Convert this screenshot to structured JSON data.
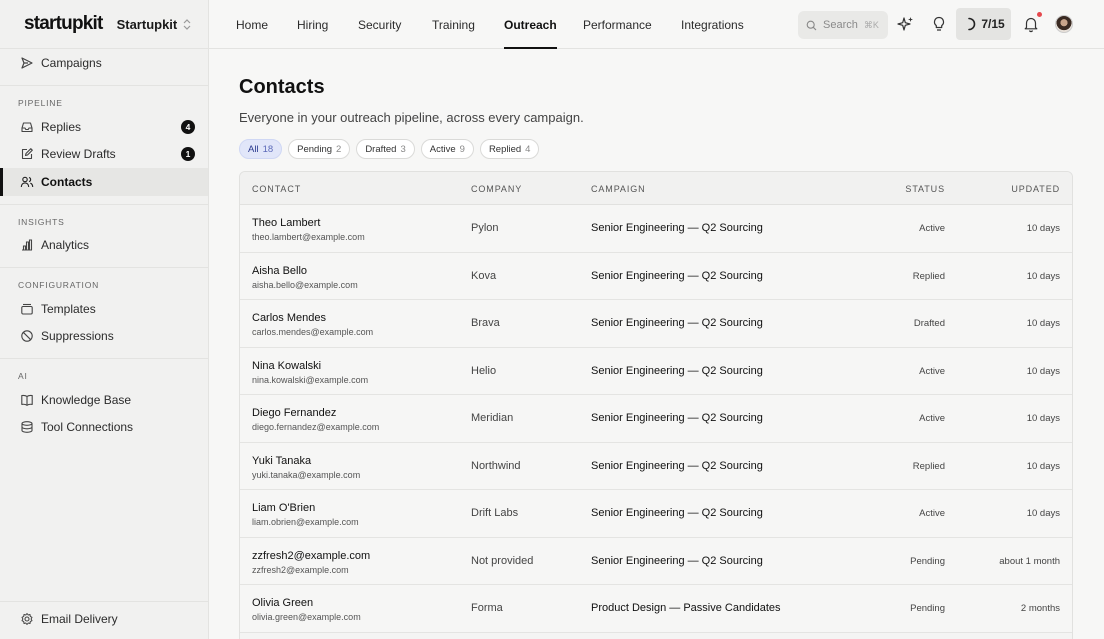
{
  "brand": {
    "logo": "startupkit",
    "workspace": "Startupkit"
  },
  "sidebar": {
    "top_item": {
      "label": "Campaigns",
      "icon": "send-icon"
    },
    "sections": [
      {
        "label": "PIPELINE",
        "items": [
          {
            "label": "Replies",
            "icon": "inbox-icon",
            "badge": "4"
          },
          {
            "label": "Review Drafts",
            "icon": "edit-icon",
            "badge": "1"
          },
          {
            "label": "Contacts",
            "icon": "users-icon",
            "active": true
          }
        ]
      },
      {
        "label": "INSIGHTS",
        "items": [
          {
            "label": "Analytics",
            "icon": "bar-chart-icon"
          }
        ]
      },
      {
        "label": "CONFIGURATION",
        "items": [
          {
            "label": "Templates",
            "icon": "templates-icon"
          },
          {
            "label": "Suppressions",
            "icon": "ban-icon"
          }
        ]
      },
      {
        "label": "AI",
        "items": [
          {
            "label": "Knowledge Base",
            "icon": "book-icon"
          },
          {
            "label": "Tool Connections",
            "icon": "database-icon"
          }
        ]
      }
    ],
    "footer_item": {
      "label": "Email Delivery",
      "icon": "gear-icon"
    }
  },
  "topnav": {
    "tabs": [
      "Home",
      "Hiring",
      "Security",
      "Training",
      "Outreach",
      "Performance",
      "Integrations"
    ],
    "active_tab": "Outreach",
    "search": {
      "placeholder": "Search",
      "shortcut": "⌘K"
    },
    "credits": "7/15"
  },
  "page": {
    "title": "Contacts",
    "subtitle": "Everyone in your outreach pipeline, across every campaign.",
    "filters": [
      {
        "label": "All",
        "count": "18",
        "active": true
      },
      {
        "label": "Pending",
        "count": "2"
      },
      {
        "label": "Drafted",
        "count": "3"
      },
      {
        "label": "Active",
        "count": "9"
      },
      {
        "label": "Replied",
        "count": "4"
      }
    ]
  },
  "table": {
    "columns": [
      "CONTACT",
      "COMPANY",
      "CAMPAIGN",
      "STATUS",
      "UPDATED"
    ],
    "rows": [
      {
        "name": "Theo Lambert",
        "email": "theo.lambert@example.com",
        "company": "Pylon",
        "campaign": "Senior Engineering — Q2 Sourcing",
        "status": "Active",
        "updated": "10 days"
      },
      {
        "name": "Aisha Bello",
        "email": "aisha.bello@example.com",
        "company": "Kova",
        "campaign": "Senior Engineering — Q2 Sourcing",
        "status": "Replied",
        "updated": "10 days"
      },
      {
        "name": "Carlos Mendes",
        "email": "carlos.mendes@example.com",
        "company": "Brava",
        "campaign": "Senior Engineering — Q2 Sourcing",
        "status": "Drafted",
        "updated": "10 days"
      },
      {
        "name": "Nina Kowalski",
        "email": "nina.kowalski@example.com",
        "company": "Helio",
        "campaign": "Senior Engineering — Q2 Sourcing",
        "status": "Active",
        "updated": "10 days"
      },
      {
        "name": "Diego Fernandez",
        "email": "diego.fernandez@example.com",
        "company": "Meridian",
        "campaign": "Senior Engineering — Q2 Sourcing",
        "status": "Active",
        "updated": "10 days"
      },
      {
        "name": "Yuki Tanaka",
        "email": "yuki.tanaka@example.com",
        "company": "Northwind",
        "campaign": "Senior Engineering — Q2 Sourcing",
        "status": "Replied",
        "updated": "10 days"
      },
      {
        "name": "Liam O'Brien",
        "email": "liam.obrien@example.com",
        "company": "Drift Labs",
        "campaign": "Senior Engineering — Q2 Sourcing",
        "status": "Active",
        "updated": "10 days"
      },
      {
        "name": "zzfresh2@example.com",
        "email": "zzfresh2@example.com",
        "company": "Not provided",
        "campaign": "Senior Engineering — Q2 Sourcing",
        "status": "Pending",
        "updated": "about 1 month"
      },
      {
        "name": "Olivia Green",
        "email": "olivia.green@example.com",
        "company": "Forma",
        "campaign": "Product Design — Passive Candidates",
        "status": "Pending",
        "updated": "2 months"
      }
    ]
  }
}
